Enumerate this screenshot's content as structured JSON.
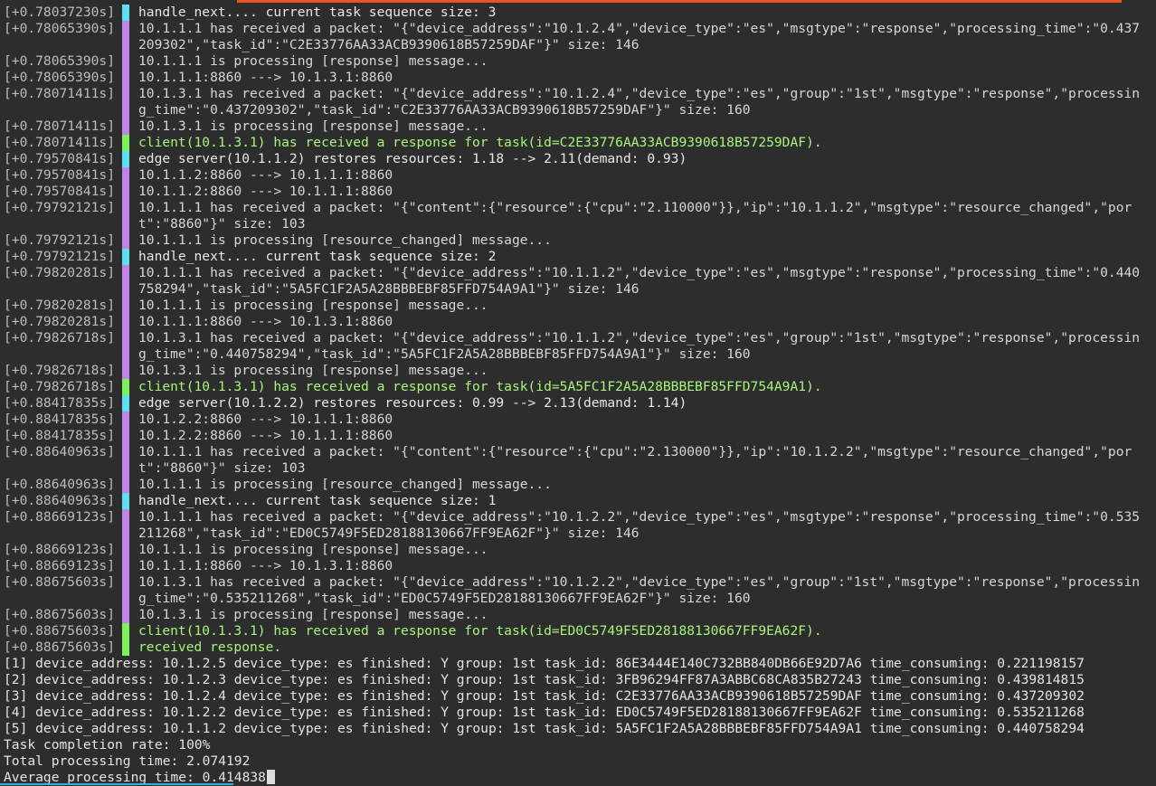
{
  "log": [
    {
      "ts": "[+0.78037230s]",
      "c": "cyan",
      "msg": "handle_next.... current task sequence size: 3"
    },
    {
      "ts": "[+0.78065390s]",
      "c": "magenta",
      "msg": "10.1.1.1 has received a packet: \"{\"device_address\":\"10.1.2.4\",\"device_type\":\"es\",\"msgtype\":\"response\",\"processing_time\":\"0.437209302\",\"task_id\":\"C2E33776AA33ACB9390618B57259DAF\"}\" size: 146"
    },
    {
      "ts": "[+0.78065390s]",
      "c": "magenta",
      "msg": "10.1.1.1 is processing [response] message..."
    },
    {
      "ts": "[+0.78065390s]",
      "c": "magenta",
      "msg": "10.1.1.1:8860 ---> 10.1.3.1:8860"
    },
    {
      "ts": "[+0.78071411s]",
      "c": "magenta",
      "msg": "10.1.3.1 has received a packet: \"{\"device_address\":\"10.1.2.4\",\"device_type\":\"es\",\"group\":\"1st\",\"msgtype\":\"response\",\"processing_time\":\"0.437209302\",\"task_id\":\"C2E33776AA33ACB9390618B57259DAF\"}\" size: 160"
    },
    {
      "ts": "[+0.78071411s]",
      "c": "magenta",
      "msg": "10.1.3.1 is processing [response] message..."
    },
    {
      "ts": "[+0.78071411s]",
      "c": "green",
      "msg": "client(10.1.3.1) has received a response for task(id=C2E33776AA33ACB9390618B57259DAF)."
    },
    {
      "ts": "[+0.79570841s]",
      "c": "cyan",
      "msg": "edge server(10.1.1.2) restores resources: 1.18 --> 2.11(demand: 0.93)"
    },
    {
      "ts": "[+0.79570841s]",
      "c": "magenta",
      "msg": "10.1.1.2:8860 ---> 10.1.1.1:8860"
    },
    {
      "ts": "[+0.79570841s]",
      "c": "magenta",
      "msg": "10.1.1.2:8860 ---> 10.1.1.1:8860"
    },
    {
      "ts": "[+0.79792121s]",
      "c": "magenta",
      "msg": "10.1.1.1 has received a packet: \"{\"content\":{\"resource\":{\"cpu\":\"2.110000\"}},\"ip\":\"10.1.1.2\",\"msgtype\":\"resource_changed\",\"port\":\"8860\"}\" size: 103"
    },
    {
      "ts": "[+0.79792121s]",
      "c": "magenta",
      "msg": "10.1.1.1 is processing [resource_changed] message..."
    },
    {
      "ts": "[+0.79792121s]",
      "c": "cyan",
      "msg": "handle_next.... current task sequence size: 2"
    },
    {
      "ts": "[+0.79820281s]",
      "c": "magenta",
      "msg": "10.1.1.1 has received a packet: \"{\"device_address\":\"10.1.1.2\",\"device_type\":\"es\",\"msgtype\":\"response\",\"processing_time\":\"0.440758294\",\"task_id\":\"5A5FC1F2A5A28BBBEBF85FFD754A9A1\"}\" size: 146"
    },
    {
      "ts": "[+0.79820281s]",
      "c": "magenta",
      "msg": "10.1.1.1 is processing [response] message..."
    },
    {
      "ts": "[+0.79820281s]",
      "c": "magenta",
      "msg": "10.1.1.1:8860 ---> 10.1.3.1:8860"
    },
    {
      "ts": "[+0.79826718s]",
      "c": "magenta",
      "msg": "10.1.3.1 has received a packet: \"{\"device_address\":\"10.1.1.2\",\"device_type\":\"es\",\"group\":\"1st\",\"msgtype\":\"response\",\"processing_time\":\"0.440758294\",\"task_id\":\"5A5FC1F2A5A28BBBEBF85FFD754A9A1\"}\" size: 160"
    },
    {
      "ts": "[+0.79826718s]",
      "c": "magenta",
      "msg": "10.1.3.1 is processing [response] message..."
    },
    {
      "ts": "[+0.79826718s]",
      "c": "green",
      "msg": "client(10.1.3.1) has received a response for task(id=5A5FC1F2A5A28BBBEBF85FFD754A9A1)."
    },
    {
      "ts": "[+0.88417835s]",
      "c": "cyan",
      "msg": "edge server(10.1.2.2) restores resources: 0.99 --> 2.13(demand: 1.14)"
    },
    {
      "ts": "[+0.88417835s]",
      "c": "magenta",
      "msg": "10.1.2.2:8860 ---> 10.1.1.1:8860"
    },
    {
      "ts": "[+0.88417835s]",
      "c": "magenta",
      "msg": "10.1.2.2:8860 ---> 10.1.1.1:8860"
    },
    {
      "ts": "[+0.88640963s]",
      "c": "magenta",
      "msg": "10.1.1.1 has received a packet: \"{\"content\":{\"resource\":{\"cpu\":\"2.130000\"}},\"ip\":\"10.1.2.2\",\"msgtype\":\"resource_changed\",\"port\":\"8860\"}\" size: 103"
    },
    {
      "ts": "[+0.88640963s]",
      "c": "magenta",
      "msg": "10.1.1.1 is processing [resource_changed] message..."
    },
    {
      "ts": "[+0.88640963s]",
      "c": "cyan",
      "msg": "handle_next.... current task sequence size: 1"
    },
    {
      "ts": "[+0.88669123s]",
      "c": "magenta",
      "msg": "10.1.1.1 has received a packet: \"{\"device_address\":\"10.1.2.2\",\"device_type\":\"es\",\"msgtype\":\"response\",\"processing_time\":\"0.535211268\",\"task_id\":\"ED0C5749F5ED28188130667FF9EA62F\"}\" size: 146"
    },
    {
      "ts": "[+0.88669123s]",
      "c": "magenta",
      "msg": "10.1.1.1 is processing [response] message..."
    },
    {
      "ts": "[+0.88669123s]",
      "c": "magenta",
      "msg": "10.1.1.1:8860 ---> 10.1.3.1:8860"
    },
    {
      "ts": "[+0.88675603s]",
      "c": "magenta",
      "msg": "10.1.3.1 has received a packet: \"{\"device_address\":\"10.1.2.2\",\"device_type\":\"es\",\"group\":\"1st\",\"msgtype\":\"response\",\"processing_time\":\"0.535211268\",\"task_id\":\"ED0C5749F5ED28188130667FF9EA62F\"}\" size: 160"
    },
    {
      "ts": "[+0.88675603s]",
      "c": "magenta",
      "msg": "10.1.3.1 is processing [response] message..."
    },
    {
      "ts": "[+0.88675603s]",
      "c": "green",
      "msg": "client(10.1.3.1) has received a response for task(id=ED0C5749F5ED28188130667FF9EA62F)."
    },
    {
      "ts": "[+0.88675603s]",
      "c": "green",
      "msg": "received response."
    }
  ],
  "summary": [
    "[1] device_address: 10.1.2.5 device_type: es finished: Y group: 1st task_id: 86E3444E140C732BB840DB66E92D7A6 time_consuming: 0.221198157",
    "[2] device_address: 10.1.2.3 device_type: es finished: Y group: 1st task_id: 3FB96294FF87A3ABBC68CA835B27243 time_consuming: 0.439814815",
    "[3] device_address: 10.1.2.4 device_type: es finished: Y group: 1st task_id: C2E33776AA33ACB9390618B57259DAF time_consuming: 0.437209302",
    "[4] device_address: 10.1.2.2 device_type: es finished: Y group: 1st task_id: ED0C5749F5ED28188130667FF9EA62F time_consuming: 0.535211268",
    "[5] device_address: 10.1.1.2 device_type: es finished: Y group: 1st task_id: 5A5FC1F2A5A28BBBEBF85FFD754A9A1 time_consuming: 0.440758294"
  ],
  "stats": {
    "completion_rate": "Task completion rate: 100%",
    "total_time": "Total processing time: 2.074192",
    "avg_time": "Average processing time: 0.414838"
  },
  "colors": {
    "cyan": "#5ee0ee",
    "magenta": "#c283e8",
    "green": "#7bf25a",
    "accent": "#e9541f"
  }
}
